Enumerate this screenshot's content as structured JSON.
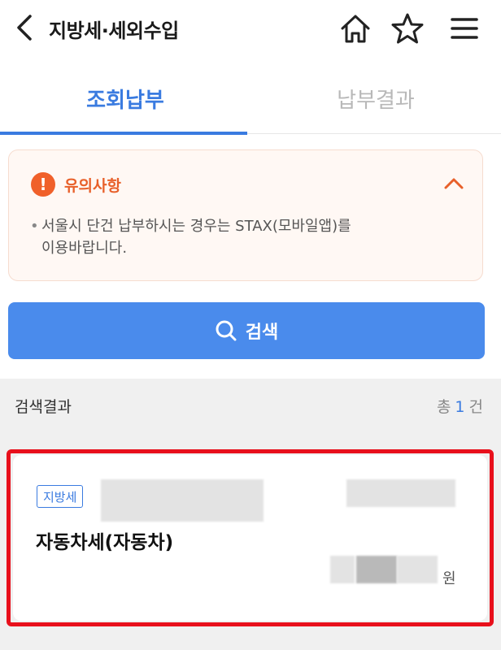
{
  "header": {
    "title": "지방세·세외수입",
    "icons": [
      "chevron-left-icon",
      "home-icon",
      "star-icon",
      "menu-icon"
    ]
  },
  "tabs": [
    {
      "label": "조회납부",
      "active": true
    },
    {
      "label": "납부결과",
      "active": false
    }
  ],
  "notice": {
    "icon_text": "!",
    "title": "유의사항",
    "bullet": "•",
    "line1": "서울시 단건 납부하시는 경우는 STAX(모바일앱)를",
    "line2": "이용바랍니다."
  },
  "search": {
    "label": "검색"
  },
  "results": {
    "label": "검색결과",
    "count_prefix": "총",
    "count": "1",
    "count_suffix": "건"
  },
  "card": {
    "tag": "지방세",
    "title": "자동차세(자동차)",
    "currency": "원"
  },
  "colors": {
    "accent": "#3a7be0",
    "button": "#4a8bec",
    "notice": "#f0602a",
    "highlight": "#e8101c"
  }
}
